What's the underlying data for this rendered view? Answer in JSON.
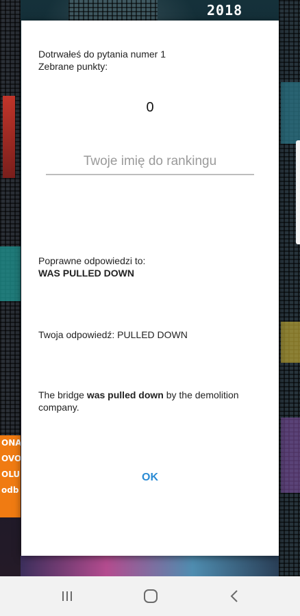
{
  "background": {
    "sign_text": "2018",
    "billboard_lines": [
      "ONA",
      "OVO",
      "OLU",
      "odb"
    ]
  },
  "dialog": {
    "reached_text": "Dotrwałeś do pytania numer 1",
    "points_label": "Zebrane punkty:",
    "score": "0",
    "name_placeholder": "Twoje imię do rankingu",
    "name_value": "",
    "correct_label": "Poprawne odpowiedzi to:",
    "correct_answer": "WAS PULLED DOWN",
    "your_answer_text": "Twoja odpowiedź: PULLED DOWN",
    "sentence_before": "The bridge ",
    "sentence_bold": "was pulled down",
    "sentence_after": " by the demolition company.",
    "ok_label": "OK"
  },
  "navbar": {
    "icons": [
      "recent-apps-icon",
      "home-icon",
      "back-icon"
    ]
  },
  "colors": {
    "accent": "#2a8bd4",
    "dialog_bg": "#ffffff",
    "navbar_bg": "#f2f2f2"
  }
}
